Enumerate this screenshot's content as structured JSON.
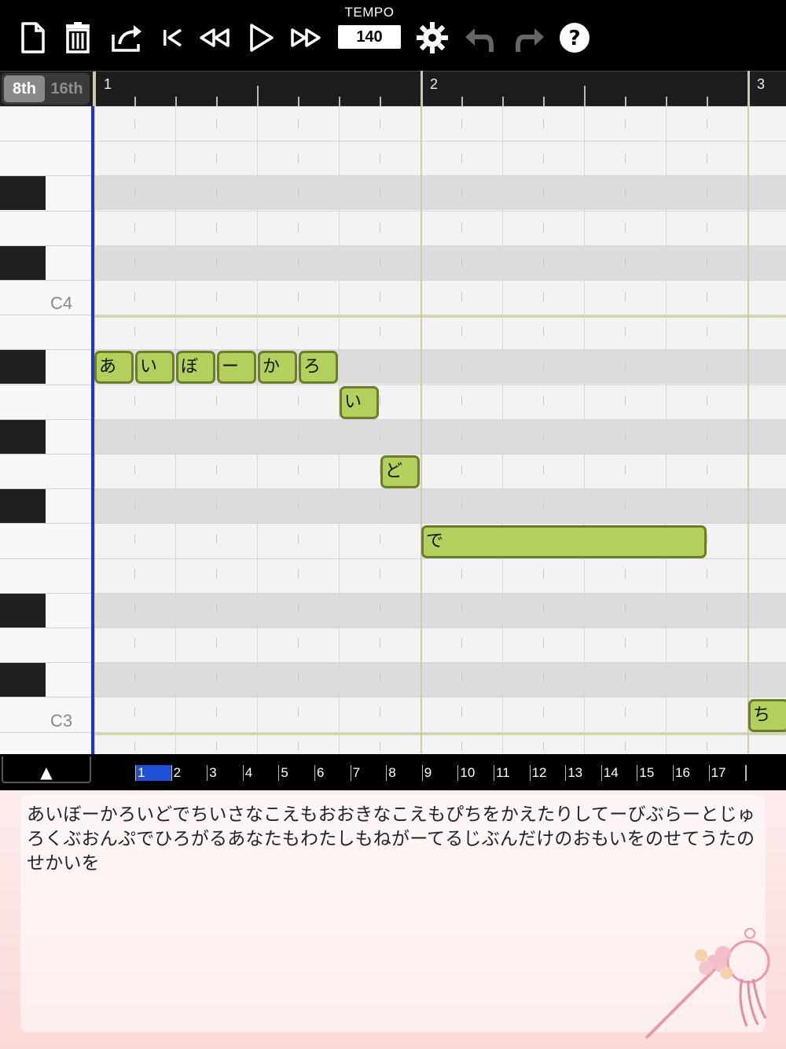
{
  "toolbar": {
    "buttons": [
      {
        "name": "new-document-icon"
      },
      {
        "name": "trash-icon"
      },
      {
        "name": "share-icon"
      },
      {
        "name": "skip-to-start-icon"
      },
      {
        "name": "rewind-icon"
      },
      {
        "name": "play-icon"
      },
      {
        "name": "fast-forward-icon"
      },
      {
        "name": "settings-gear-icon"
      },
      {
        "name": "undo-icon"
      },
      {
        "name": "redo-icon"
      },
      {
        "name": "help-icon"
      }
    ],
    "tempo_label": "TEMPO",
    "tempo_value": "140"
  },
  "ruler": {
    "segment": {
      "options": [
        "8th",
        "16th"
      ],
      "selected": "8th"
    },
    "bars": [
      "1",
      "2",
      "3"
    ]
  },
  "keyboard": {
    "labels": {
      "c4": "C4",
      "c3": "C3"
    }
  },
  "notes": [
    "あ",
    "い",
    "ぼ",
    "ー",
    "か",
    "ろ",
    "い",
    "ど",
    "で",
    "ち"
  ],
  "navigator": {
    "collapse_symbol": "▲",
    "measures": [
      "1",
      "2",
      "3",
      "4",
      "5",
      "6",
      "7",
      "8",
      "9",
      "10",
      "11",
      "12",
      "13",
      "14",
      "15",
      "16",
      "17"
    ],
    "selected_measure": "1"
  },
  "lyrics": {
    "text": "あいぼーかろいどでちいさなこえもおおきなこえもぴちをかえたりしてーびぶらーとじゅろくぶおんぷでひろがるあなたもわたしもねがーてるじぶんだけのおもいをのせてうたのせかいを"
  },
  "colors": {
    "note_fill": "#b3d05c",
    "note_border": "#6b7d2b",
    "playhead": "#1e37c9",
    "nav_selection": "#1e4fd6"
  }
}
